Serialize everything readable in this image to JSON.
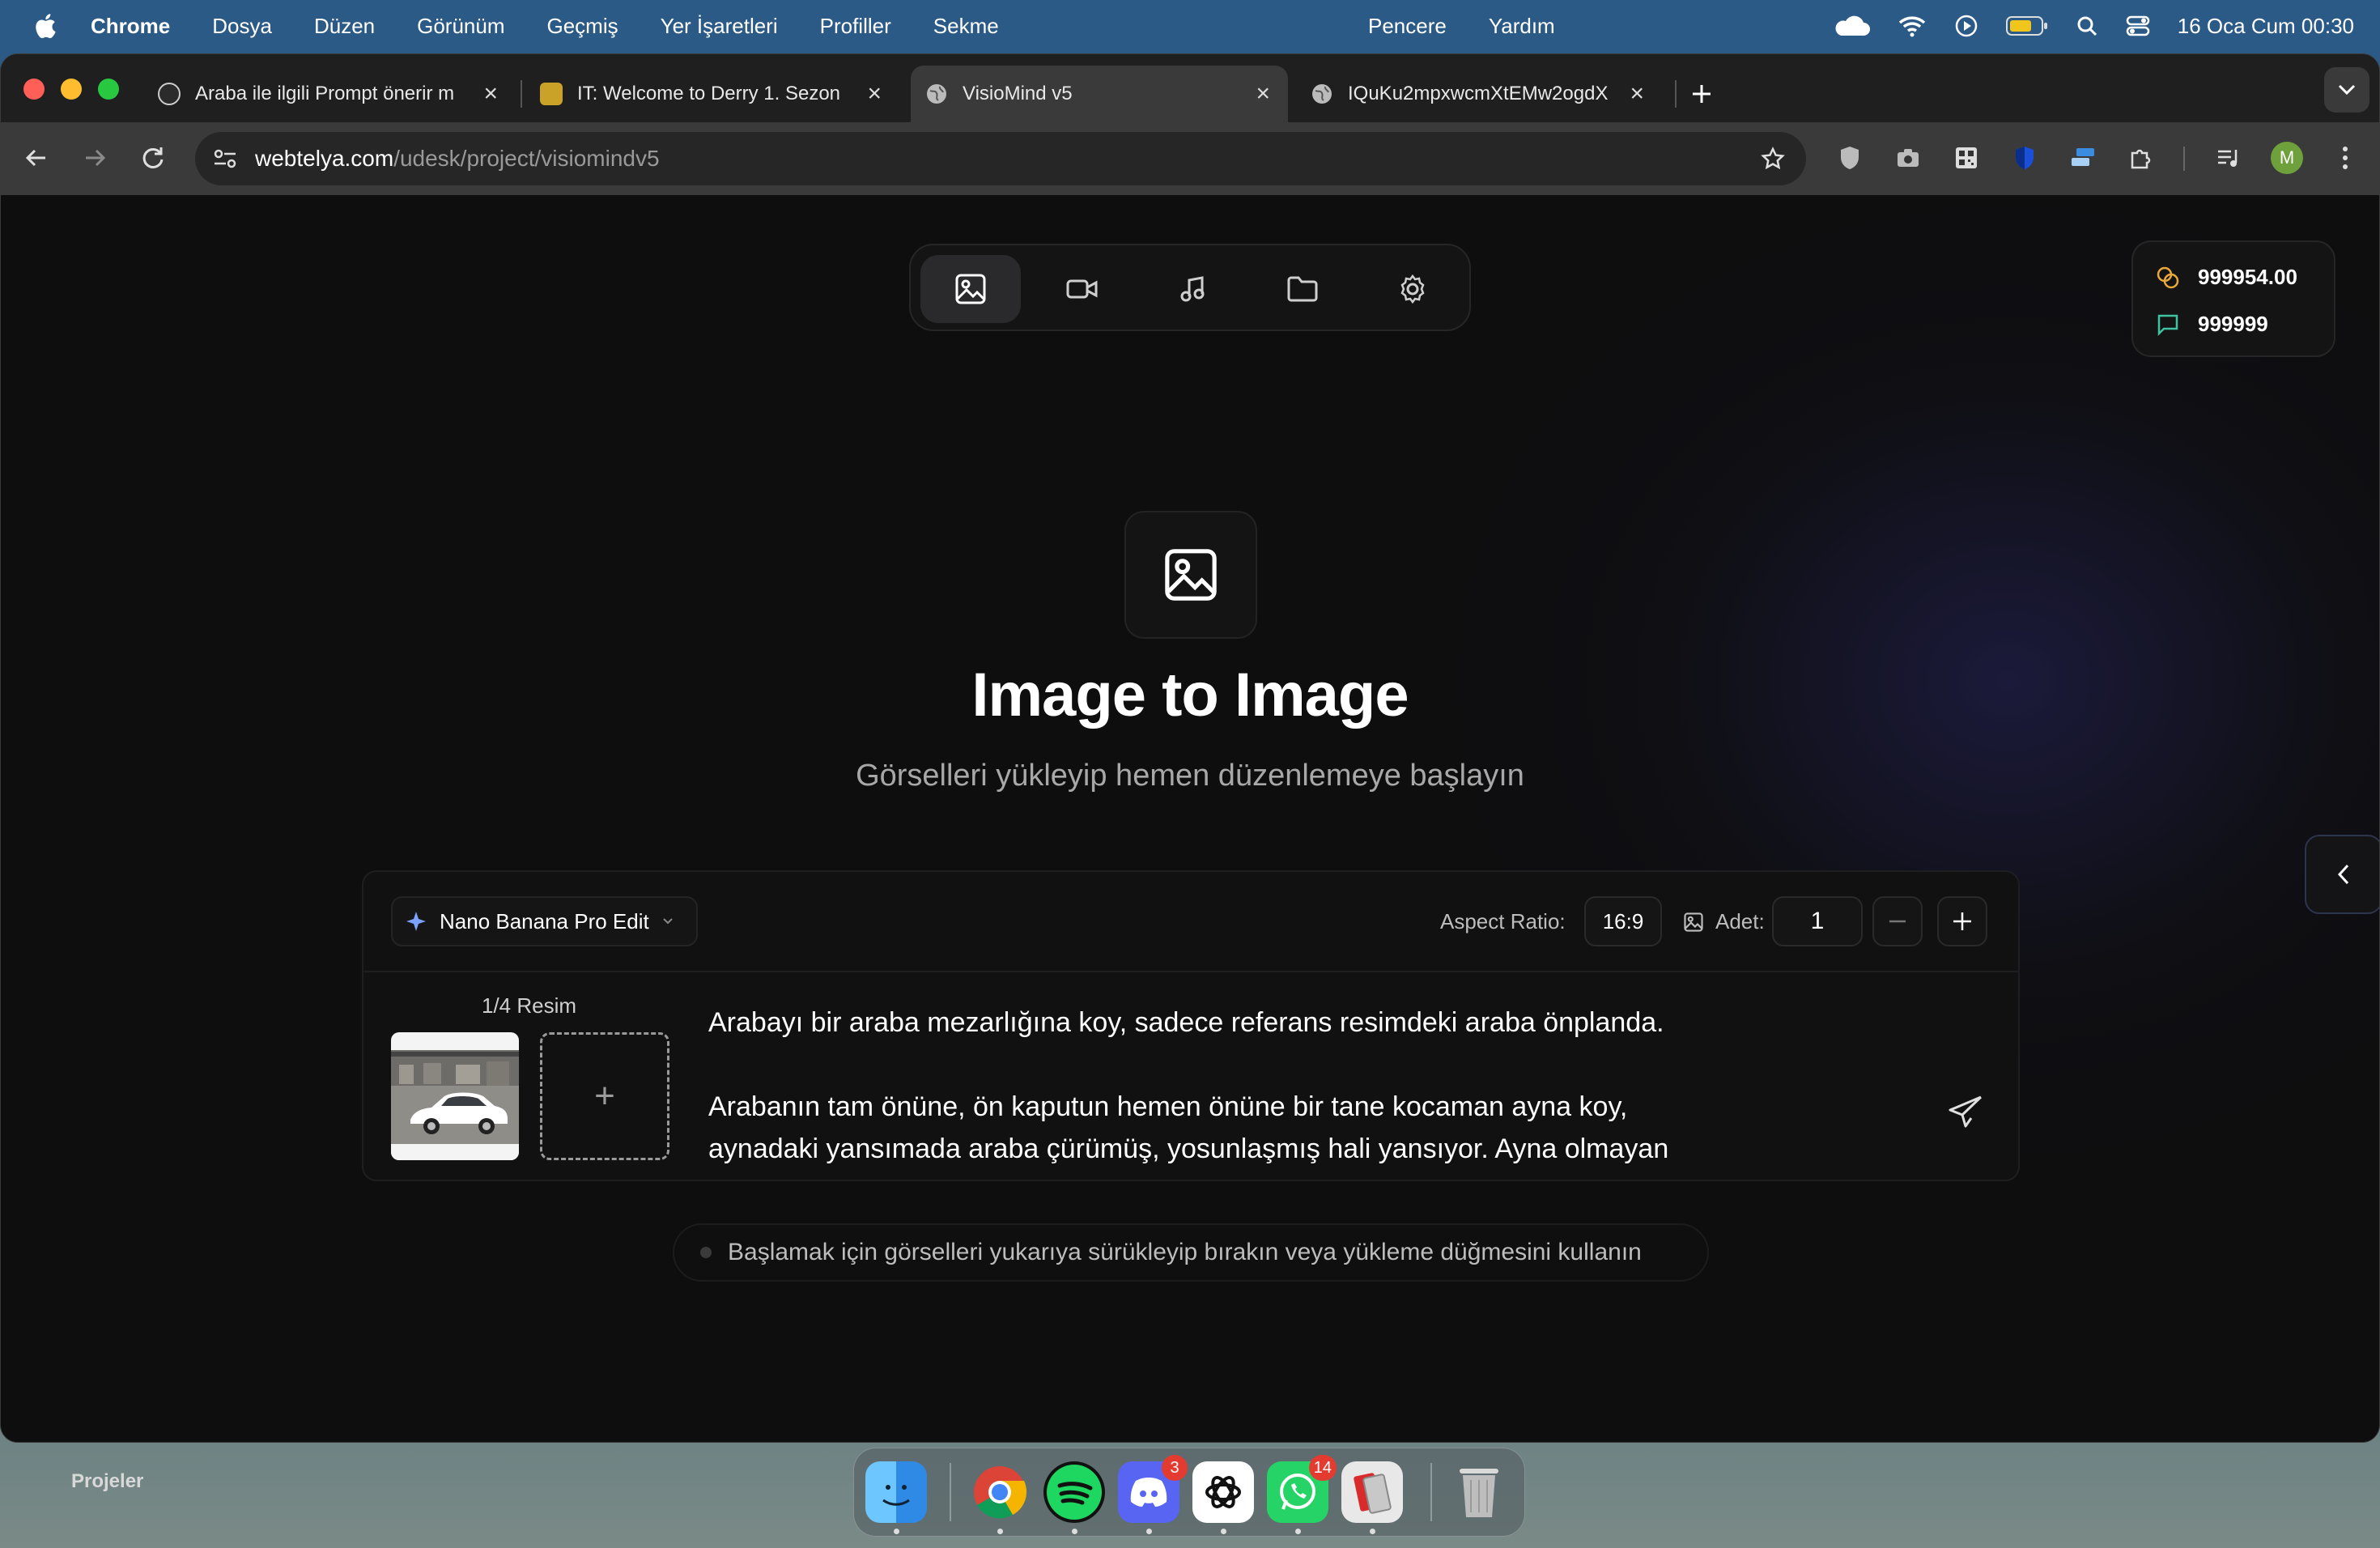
{
  "menubar": {
    "app": "Chrome",
    "items": [
      "Dosya",
      "Düzen",
      "Görünüm",
      "Geçmiş",
      "Yer İşaretleri",
      "Profiller",
      "Sekme"
    ],
    "right_items": [
      "Pencere",
      "Yardım"
    ],
    "clock": "16 Oca Cum  00:30"
  },
  "tabs": [
    {
      "title": "Araba ile ilgili Prompt önerir m"
    },
    {
      "title": "IT: Welcome to Derry 1. Sezon"
    },
    {
      "title": "VisioMind v5"
    },
    {
      "title": "IQuKu2mpxwcmXtEMw2ogdX"
    }
  ],
  "address": {
    "host": "webtelya.com",
    "path": "/udesk/project/visiomindv5"
  },
  "profile_initial": "M",
  "credits": {
    "coins": "999954.00",
    "messages": "999999"
  },
  "hero": {
    "title": "Image to Image",
    "subtitle": "Görselleri yükleyip hemen düzenlemeye başlayın"
  },
  "panel": {
    "model": "Nano Banana Pro Edit",
    "aspect_label": "Aspect Ratio:",
    "aspect_value": "16:9",
    "count_label": "Adet:",
    "count_value": "1",
    "image_count": "1/4 Resim",
    "add_symbol": "+",
    "prompt": "Arabayı bir araba mezarlığına koy, sadece referans resimdeki araba önplanda.\n\nArabanın tam önüne, ön kaputun hemen önüne bir tane kocaman ayna koy,\naynadaki yansımada araba çürümüş, yosunlaşmış hali yansıyor. Ayna olmayan"
  },
  "hint": "Başlamak için görselleri yukarıya sürükleyip bırakın veya yükleme düğmesini kullanın",
  "desktop": {
    "label": "Projeler"
  },
  "dock": {
    "discord_badge": "3",
    "whatsapp_badge": "14"
  }
}
